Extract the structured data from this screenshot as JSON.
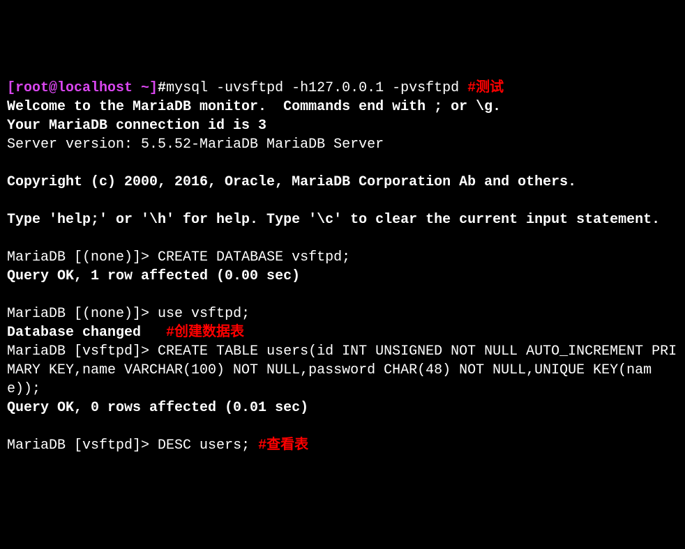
{
  "terminal": {
    "prompt1": {
      "user_host": "[root@localhost ~]",
      "hash": "#",
      "command": "mysql -uvsftpd -h127.0.0.1 -pvsftpd ",
      "comment": "#测试"
    },
    "welcome_line1": "Welcome to the MariaDB monitor.  Commands end with ; or \\g.",
    "welcome_line2": "Your MariaDB connection id is 3",
    "welcome_line3": "Server version: 5.5.52-MariaDB MariaDB Server",
    "copyright": "Copyright (c) 2000, 2016, Oracle, MariaDB Corporation Ab and others.",
    "help_line": "Type 'help;' or '\\h' for help. Type '\\c' to clear the current input statement.",
    "mariadb_prompt1": "MariaDB [(none)]> ",
    "create_db": "CREATE DATABASE vsftpd;",
    "query_ok1": "Query OK, 1 row affected (0.00 sec)",
    "mariadb_prompt2": "MariaDB [(none)]> ",
    "use_db": "use vsftpd;",
    "db_changed": "Database changed",
    "comment2": "   #创建数据表",
    "mariadb_prompt3": "MariaDB [vsftpd]> ",
    "create_table": "CREATE TABLE users(id INT UNSIGNED NOT NULL AUTO_INCREMENT PRIMARY KEY,name VARCHAR(100) NOT NULL,password CHAR(48) NOT NULL,UNIQUE KEY(name));",
    "query_ok2": "Query OK, 0 rows affected (0.01 sec)",
    "mariadb_prompt4": "MariaDB [vsftpd]> ",
    "desc_users": "DESC users; ",
    "comment3": "#查看表"
  }
}
